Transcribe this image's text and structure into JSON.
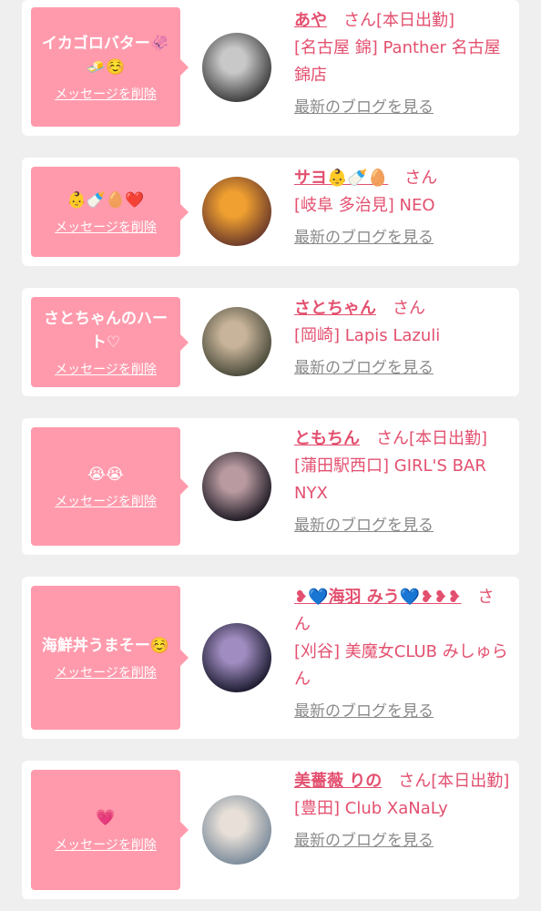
{
  "items": [
    {
      "message": "イカゴロバター🦑🧈☺️",
      "delete_label": "メッセージを削除",
      "name": "あや",
      "honorific": "さん",
      "status": "[本日出勤]",
      "shop": "[名古屋 錦] Panther 名古屋錦店",
      "blog_label": "最新のブログを見る",
      "avatar_colors": [
        "#3c3c3c",
        "#c8c8c8"
      ]
    },
    {
      "message": "👶🍼🥚❤️",
      "delete_label": "メッセージを削除",
      "name": "サヨ👶🍼🥚",
      "honorific": "さん",
      "status": "",
      "shop": "[岐阜 多治見] NEO",
      "blog_label": "最新のブログを見る",
      "avatar_colors": [
        "#6b3a2a",
        "#f0a030"
      ]
    },
    {
      "message": "さとちゃんのハート♡",
      "delete_label": "メッセージを削除",
      "name": "さとちゃん",
      "honorific": "さん",
      "status": "",
      "shop": "[岡崎] Lapis Lazuli",
      "blog_label": "最新のブログを見る",
      "avatar_colors": [
        "#4a4a3a",
        "#c8b49a"
      ]
    },
    {
      "message": "😭😭",
      "delete_label": "メッセージを削除",
      "name": "ともちん",
      "honorific": "さん",
      "status": "[本日出勤]",
      "shop": "[蒲田駅西口] GIRL'S BAR NYX",
      "blog_label": "最新のブログを見る",
      "avatar_colors": [
        "#1e1a24",
        "#b89aa0"
      ]
    },
    {
      "message": "海鮮丼うまそー☺️",
      "delete_label": "メッセージを削除",
      "name": "❥💙海羽 みう💙❥❥❥",
      "honorific": "さん",
      "status": "",
      "shop": "[刈谷] 美魔女CLUB みしゅらん",
      "blog_label": "最新のブログを見る",
      "avatar_colors": [
        "#1a1a2e",
        "#a08cc0"
      ]
    },
    {
      "message": "💗",
      "delete_label": "メッセージを削除",
      "name": "美薔薇 りの",
      "honorific": "さん",
      "status": "[本日出勤]",
      "shop": "[豊田] Club XaNaLy",
      "blog_label": "最新のブログを見る",
      "avatar_colors": [
        "#7a8a9a",
        "#e8e0d8"
      ]
    }
  ]
}
